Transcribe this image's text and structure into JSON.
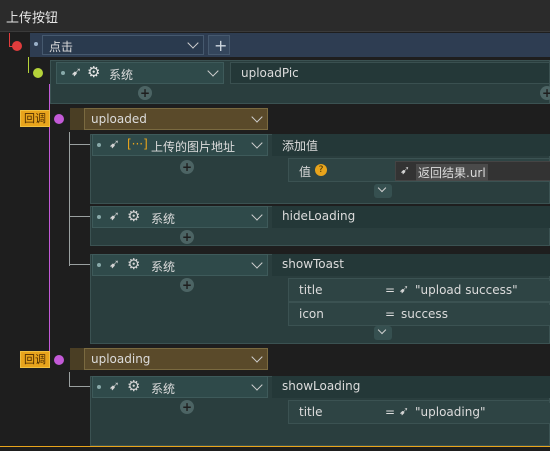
{
  "title": "上传按钮",
  "trigger": {
    "event": "点击",
    "add": "+"
  },
  "root_action": {
    "category": "系统",
    "method": "uploadPic"
  },
  "callbacks": [
    {
      "badge": "回调",
      "name": "uploaded"
    },
    {
      "badge": "回调",
      "name": "uploading"
    }
  ],
  "uploaded_actions": [
    {
      "category": "上传的图片地址",
      "method": "添加值",
      "params": [
        {
          "label": "值",
          "help": "?",
          "value": "返回结果.url"
        }
      ]
    },
    {
      "category": "系统",
      "method": "hideLoading"
    },
    {
      "category": "系统",
      "method": "showToast",
      "params": [
        {
          "label": "title",
          "eq": "=",
          "value": "\"upload success\""
        },
        {
          "label": "icon",
          "eq": "=",
          "value": "success"
        }
      ]
    }
  ],
  "uploading_actions": [
    {
      "category": "系统",
      "method": "showLoading",
      "params": [
        {
          "label": "title",
          "eq": "=",
          "value": "\"uploading\""
        }
      ]
    }
  ],
  "colors": {
    "accent": "#e8a41c",
    "trigger_dot": "#e03c3c",
    "action_dot": "#b5d33a",
    "callback_dot": "#c35ad8"
  }
}
